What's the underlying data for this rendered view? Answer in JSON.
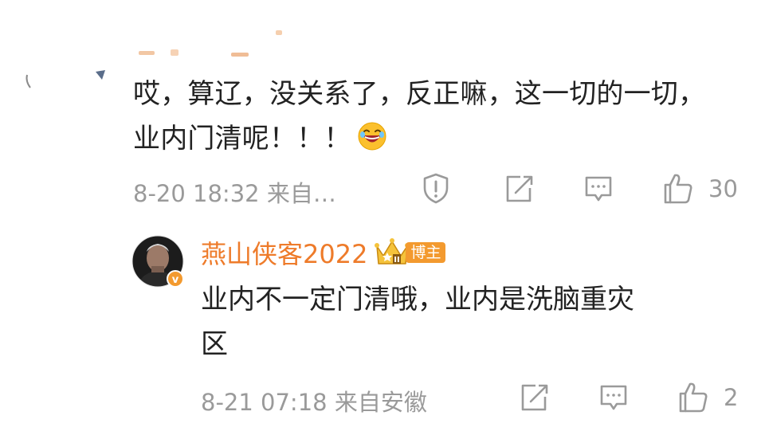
{
  "comment": {
    "lines": [
      "哎，算辽，没关系了，反正嘛，这一切的一切，",
      "业内门清呢！！！"
    ],
    "emoji": "grinning-tears-emoji",
    "time": "8-20 18:32",
    "source": "来自…",
    "like_count": "30"
  },
  "reply": {
    "author": "燕山侠客2022",
    "badge": "博主",
    "lines": [
      "业内不一定门清哦，业内是洗脑重灾",
      "区"
    ],
    "time": "8-21 07:18",
    "source": "来自安徽",
    "like_count": "2"
  },
  "colors": {
    "meta_gray": "#9a9a9a",
    "author_orange": "#ee7b2a",
    "badge_orange": "#f39a2f",
    "text_dark": "#222222"
  }
}
